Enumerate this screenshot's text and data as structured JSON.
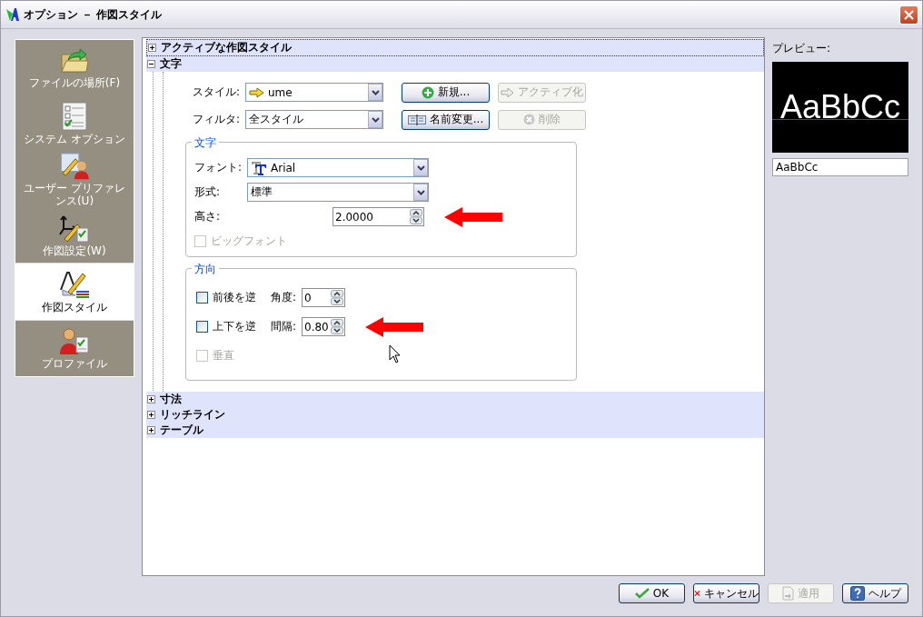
{
  "window": {
    "title": "オプション － 作図スタイル"
  },
  "sidebar": {
    "items": [
      {
        "label": "ファイルの場所(F)",
        "selected": false
      },
      {
        "label": "システム オプション",
        "selected": false
      },
      {
        "label": "ユーザー プリファレンス(U)",
        "selected": false
      },
      {
        "label": "作図設定(W)",
        "selected": false
      },
      {
        "label": "作図スタイル",
        "selected": true
      },
      {
        "label": "プロファイル",
        "selected": false
      }
    ]
  },
  "sections": [
    {
      "title": "アクティブな作図スタイル",
      "expanded": false
    },
    {
      "title": "文字",
      "expanded": true
    },
    {
      "title": "寸法",
      "expanded": false
    },
    {
      "title": "リッチライン",
      "expanded": false
    },
    {
      "title": "テーブル",
      "expanded": false
    }
  ],
  "text_style": {
    "style_label": "スタイル:",
    "style_value": "ume",
    "filter_label": "フィルタ:",
    "filter_value": "全スタイル",
    "buttons": [
      {
        "label": "新規...",
        "disabled": false
      },
      {
        "label": "アクティブ化",
        "disabled": true
      },
      {
        "label": "名前変更...",
        "disabled": false
      },
      {
        "label": "削除",
        "disabled": true
      }
    ],
    "text_group": {
      "title": "文字",
      "font_label": "フォント:",
      "font_value": "Arial",
      "format_label": "形式:",
      "format_value": "標準",
      "height_label": "高さ:",
      "height_value": "2.0000",
      "bigfont": {
        "label": "ビッグフォント",
        "checked": false,
        "disabled": true
      }
    },
    "direction_group": {
      "title": "方向",
      "checkboxes": [
        {
          "label": "前後を逆",
          "checked": false,
          "disabled": false
        },
        {
          "label": "上下を逆",
          "checked": false,
          "disabled": false
        },
        {
          "label": "垂直",
          "checked": false,
          "disabled": true
        }
      ],
      "angle_label": "角度:",
      "angle_value": "0",
      "spacing_label": "間隔:",
      "spacing_value": "0.80"
    }
  },
  "preview": {
    "label": "プレビュー:",
    "sample": "AaBbCc",
    "text_value": "AaBbCc"
  },
  "footer": {
    "buttons": [
      {
        "label": "OK",
        "disabled": false
      },
      {
        "label": "キャンセル",
        "disabled": false
      },
      {
        "label": "適用",
        "disabled": true
      },
      {
        "label": "ヘルプ",
        "disabled": false
      }
    ]
  }
}
